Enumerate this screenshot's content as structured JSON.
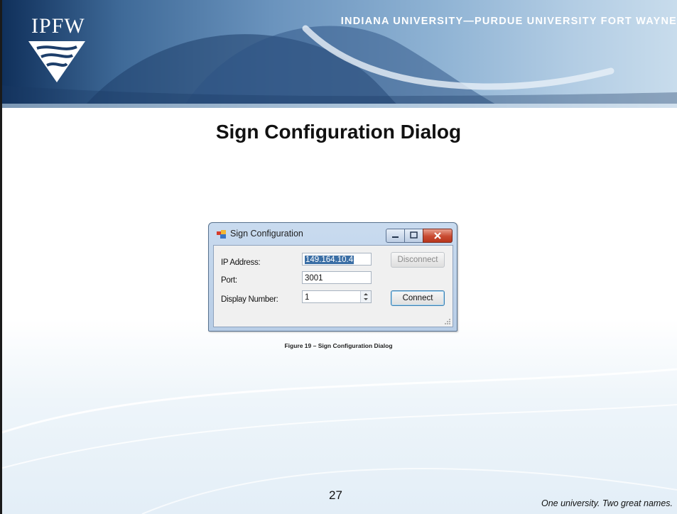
{
  "slide": {
    "logo_text": "IPFW",
    "university": "INDIANA UNIVERSITY—PURDUE UNIVERSITY FORT WAYNE",
    "title": "Sign Configuration Dialog",
    "caption": "Figure 19 – Sign Configuration Dialog",
    "page_number": "27",
    "tagline": "One university.  Two great names."
  },
  "dialog": {
    "title": "Sign Configuration",
    "fields": {
      "ip_label": "IP Address:",
      "ip_value": "149.164.10.4",
      "port_label": "Port:",
      "port_value": "3001",
      "display_label": "Display Number:",
      "display_value": "1"
    },
    "buttons": {
      "disconnect": "Disconnect",
      "connect": "Connect"
    }
  },
  "colors": {
    "banner": "#3f6a98",
    "close_button": "#c84a31",
    "default_button_border": "#3c7fb1"
  }
}
